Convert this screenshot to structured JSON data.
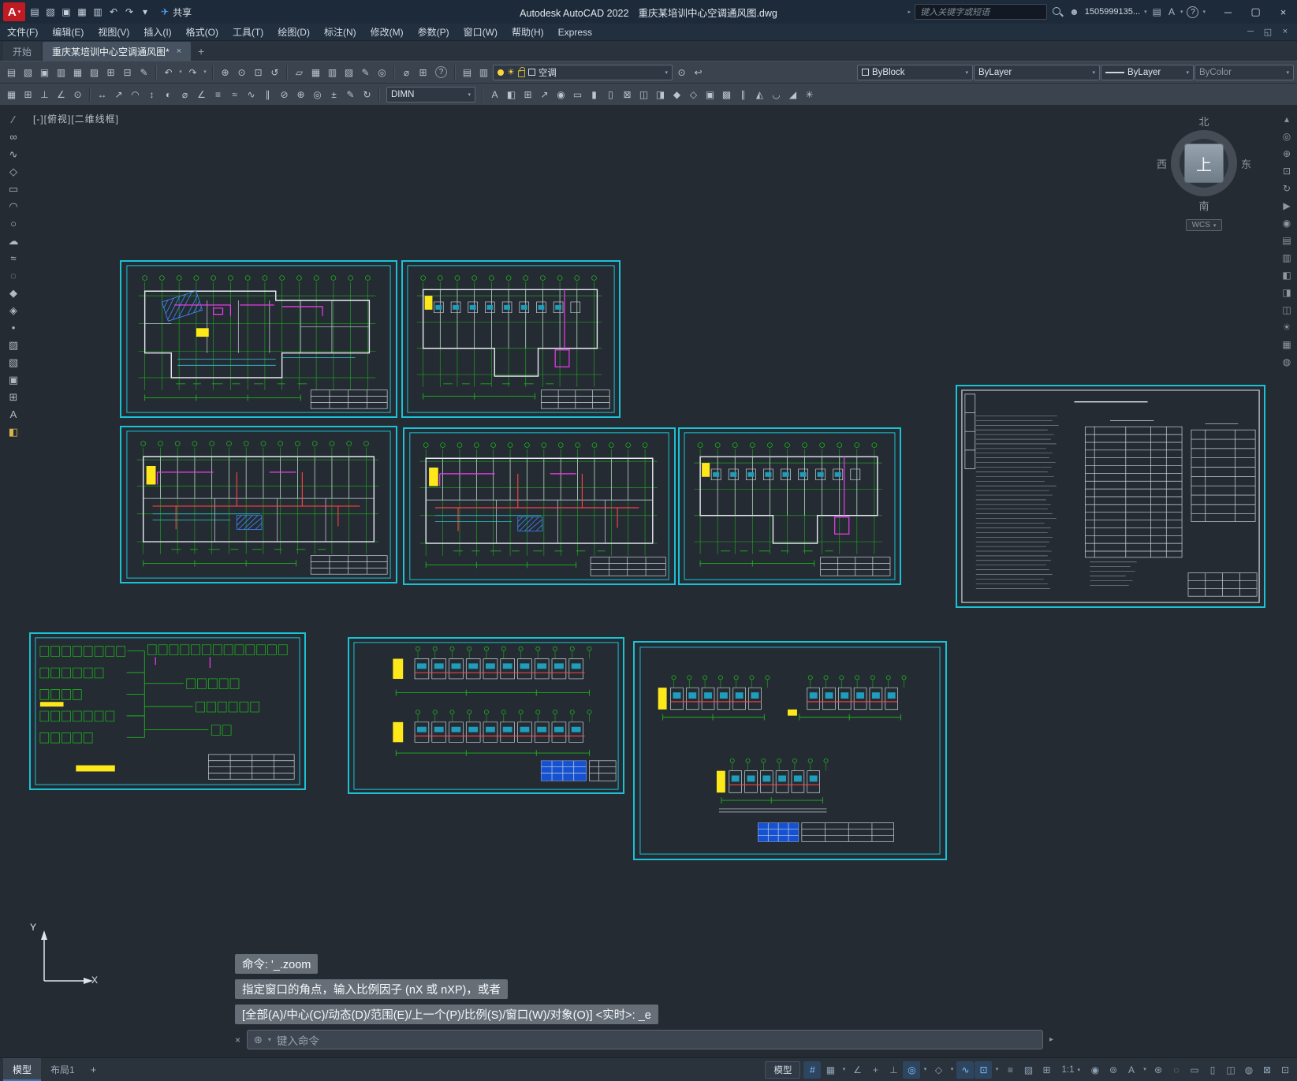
{
  "glyphs": {
    "logo_letter": "A",
    "dropdown": "▾",
    "minimize": "─",
    "maximize": "▢",
    "restore": "◱",
    "close": "×",
    "tab_close": "×",
    "add": "+",
    "share_plane": "✈",
    "avatar": "☻",
    "cart": "▤",
    "autodesk_a": "A",
    "help": "?",
    "sun": "☀",
    "input_gear": "⊛",
    "scroll_right": "▸"
  },
  "titlebar": {
    "app_title": "Autodesk AutoCAD 2022",
    "doc_title": "重庆某培训中心空调通风图.dwg",
    "share_label": "共享",
    "search_placeholder": "键入关键字或短语",
    "account": "1505999135...",
    "quick_icons": [
      {
        "name": "new-file-icon",
        "glyph": "▤"
      },
      {
        "name": "open-file-icon",
        "glyph": "▧"
      },
      {
        "name": "save-icon",
        "glyph": "▣"
      },
      {
        "name": "save-as-icon",
        "glyph": "▦"
      },
      {
        "name": "plot-icon",
        "glyph": "▥"
      },
      {
        "name": "undo-icon",
        "glyph": "↶"
      },
      {
        "name": "redo-icon",
        "glyph": "↷"
      },
      {
        "name": "qat-customize-icon",
        "glyph": "▾"
      }
    ]
  },
  "menubar": {
    "items": [
      {
        "name": "menu-file",
        "label": "文件(F)"
      },
      {
        "name": "menu-edit",
        "label": "编辑(E)"
      },
      {
        "name": "menu-view",
        "label": "视图(V)"
      },
      {
        "name": "menu-insert",
        "label": "插入(I)"
      },
      {
        "name": "menu-format",
        "label": "格式(O)"
      },
      {
        "name": "menu-tools",
        "label": "工具(T)"
      },
      {
        "name": "menu-draw",
        "label": "绘图(D)"
      },
      {
        "name": "menu-dimension",
        "label": "标注(N)"
      },
      {
        "name": "menu-modify",
        "label": "修改(M)"
      },
      {
        "name": "menu-parametric",
        "label": "参数(P)"
      },
      {
        "name": "menu-window",
        "label": "窗口(W)"
      },
      {
        "name": "menu-help",
        "label": "帮助(H)"
      },
      {
        "name": "menu-express",
        "label": "Express"
      }
    ]
  },
  "tabbar": {
    "start_label": "开始",
    "doc_label": "重庆某培训中心空调通风图*"
  },
  "toolbar1": {
    "layer_value": "空调",
    "color_value": "ByBlock",
    "linetype_value": "ByLayer",
    "lineweight_value": "ByLayer",
    "plotstyle_value": "ByColor",
    "icons_a": [
      {
        "name": "qnew-icon",
        "glyph": "▤"
      },
      {
        "name": "open-icon",
        "glyph": "▧"
      },
      {
        "name": "qsave-icon",
        "glyph": "▣"
      },
      {
        "name": "plot-icon",
        "glyph": "▥"
      },
      {
        "name": "plot-preview-icon",
        "glyph": "▦"
      },
      {
        "name": "publish-icon",
        "glyph": "▨"
      },
      {
        "name": "copy-clip-icon",
        "glyph": "⊞"
      },
      {
        "name": "paste-clip-icon",
        "glyph": "⊟"
      },
      {
        "name": "match-properties-icon",
        "glyph": "✎"
      }
    ],
    "icons_b": [
      {
        "name": "undo-icon",
        "glyph": "↶"
      },
      {
        "name": "undo-dropdown-icon",
        "glyph": "▾",
        "cls": "dd"
      },
      {
        "name": "redo-icon",
        "glyph": "↷"
      },
      {
        "name": "redo-dropdown-icon",
        "glyph": "▾",
        "cls": "dd"
      }
    ],
    "icons_c": [
      {
        "name": "pan-realtime-icon",
        "glyph": "⊕"
      },
      {
        "name": "zoom-realtime-icon",
        "gly9ph": "⊙",
        "glyph": "⊙"
      },
      {
        "name": "zoom-window-icon",
        "glyph": "⊡"
      },
      {
        "name": "zoom-previous-icon",
        "glyph": "↺"
      }
    ],
    "icons_d": [
      {
        "name": "properties-palette-icon",
        "glyph": "▱"
      },
      {
        "name": "design-center-icon",
        "glyph": "▦"
      },
      {
        "name": "tool-palettes-icon",
        "glyph": "▥"
      },
      {
        "name": "sheet-set-manager-icon",
        "glyph": "▨"
      },
      {
        "name": "markup-import-icon",
        "glyph": "✎"
      },
      {
        "name": "render-icon",
        "glyph": "◎"
      }
    ],
    "icons_e": [
      {
        "name": "measure-icon",
        "glyph": "⌀"
      },
      {
        "name": "quick-calc-icon",
        "glyph": "⊞"
      },
      {
        "name": "help-icon",
        "glyph": "?",
        "cls": "helpc"
      }
    ],
    "icons_f": [
      {
        "name": "layer-properties-manager-icon",
        "glyph": "▤"
      },
      {
        "name": "layer-states-icon",
        "glyph": "▥"
      }
    ],
    "icons_g": [
      {
        "name": "make-object-layer-current-icon",
        "glyph": "⊙"
      },
      {
        "name": "layer-previous-icon",
        "glyph": "↩"
      }
    ]
  },
  "toolbar2": {
    "dimstyle_value": "DIMN",
    "icons_a": [
      {
        "name": "snap-toggle-icon",
        "glyph": "▦"
      },
      {
        "name": "grid-toggle-icon",
        "glyph": "⊞"
      },
      {
        "name": "ortho-toggle-icon",
        "glyph": "⊥"
      },
      {
        "name": "polar-toggle-icon",
        "glyph": "∠"
      },
      {
        "name": "osnap-toggle-icon",
        "glyph": "⊙"
      }
    ],
    "icons_b": [
      {
        "name": "dim-linear-icon",
        "glyph": "↔"
      },
      {
        "name": "dim-aligned-icon",
        "glyph": "↗"
      },
      {
        "name": "dim-arc-icon",
        "glyph": "◠"
      },
      {
        "name": "dim-ordinate-icon",
        "glyph": "↕"
      },
      {
        "name": "dim-radius-icon",
        "glyph": "◐"
      },
      {
        "name": "dim-diameter-icon",
        "glyph": "⌀"
      },
      {
        "name": "dim-angular-icon",
        "glyph": "∠"
      },
      {
        "name": "dim-quick-icon",
        "glyph": "≡"
      },
      {
        "name": "dim-baseline-icon",
        "glyph": "≈"
      },
      {
        "name": "dim-continue-icon",
        "glyph": "∿"
      },
      {
        "name": "dim-space-icon",
        "glyph": "∥"
      },
      {
        "name": "dim-break-icon",
        "glyph": "⊘"
      },
      {
        "name": "tolerance-icon",
        "glyph": "⊕"
      },
      {
        "name": "center-mark-icon",
        "glyph": "◎"
      },
      {
        "name": "dim-jog-icon",
        "glyph": "±"
      },
      {
        "name": "dim-edit-icon",
        "glyph": "✎"
      },
      {
        "name": "dim-update-icon",
        "glyph": "↻"
      }
    ],
    "icons_c": [
      {
        "name": "text-style-icon",
        "glyph": "A"
      },
      {
        "name": "dim-style-icon",
        "glyph": "◧"
      },
      {
        "name": "table-style-icon",
        "glyph": "⊞"
      },
      {
        "name": "mleader-style-icon",
        "glyph": "↗"
      },
      {
        "name": "point-style-icon",
        "glyph": "◉"
      },
      {
        "name": "units-icon",
        "glyph": "▭"
      },
      {
        "name": "thickness-icon",
        "glyph": "▮"
      },
      {
        "name": "drawing-limits-icon",
        "glyph": "▯"
      },
      {
        "name": "osnap-settings-icon",
        "glyph": "⊠"
      },
      {
        "name": "object-group-icon",
        "glyph": "◫"
      },
      {
        "name": "xref-icon",
        "glyph": "◨"
      },
      {
        "name": "block-editor-icon",
        "glyph": "◆"
      },
      {
        "name": "insert-block-icon",
        "glyph": "◇"
      },
      {
        "name": "wblock-icon",
        "glyph": "▣"
      },
      {
        "name": "array-icon",
        "glyph": "▩"
      },
      {
        "name": "offset-icon",
        "glyph": "∥"
      },
      {
        "name": "mirror-icon",
        "glyph": "◭"
      },
      {
        "name": "fillet-icon",
        "glyph": "◡"
      },
      {
        "name": "chamfer-icon",
        "glyph": "◢"
      },
      {
        "name": "explode-icon",
        "glyph": "✳"
      }
    ]
  },
  "lefttools": {
    "icons": [
      {
        "name": "line-tool-icon",
        "glyph": "∕"
      },
      {
        "name": "construction-line-tool-icon",
        "glyph": "∞"
      },
      {
        "name": "polyline-tool-icon",
        "glyph": "∿"
      },
      {
        "name": "polygon-tool-icon",
        "glyph": "◇"
      },
      {
        "name": "rectangle-tool-icon",
        "glyph": "▭"
      },
      {
        "name": "arc-tool-icon",
        "glyph": "◠"
      },
      {
        "name": "circle-tool-icon",
        "glyph": "○"
      },
      {
        "name": "revision-cloud-tool-icon",
        "glyph": "☁"
      },
      {
        "name": "spline-tool-icon",
        "glyph": "≈"
      },
      {
        "name": "ellipse-tool-icon",
        "glyph": "◌"
      },
      {
        "name": "insert-block-tool-icon",
        "glyph": "◆"
      },
      {
        "name": "make-block-tool-icon",
        "glyph": "◈"
      },
      {
        "name": "point-tool-icon",
        "glyph": "•"
      },
      {
        "name": "hatch-tool-icon",
        "glyph": "▨"
      },
      {
        "name": "gradient-tool-icon",
        "glyph": "▧"
      },
      {
        "name": "region-tool-icon",
        "glyph": "▣"
      },
      {
        "name": "table-tool-icon",
        "glyph": "⊞"
      },
      {
        "name": "text-tool-icon",
        "glyph": "A"
      },
      {
        "name": "color-palette-icon",
        "glyph": "◧",
        "cls": "colorful"
      }
    ]
  },
  "rightnav": {
    "icons": [
      {
        "name": "navbar-customize-icon",
        "glyph": "▴"
      },
      {
        "name": "full-navigation-wheel-icon",
        "glyph": "◎"
      },
      {
        "name": "pan-tool-icon",
        "glyph": "⊕"
      },
      {
        "name": "zoom-extents-icon",
        "glyph": "⊡"
      },
      {
        "name": "orbit-tool-icon",
        "glyph": "↻"
      },
      {
        "name": "show-motion-icon",
        "glyph": "▶"
      },
      {
        "name": "viewcube-settings-icon",
        "glyph": "◉"
      },
      {
        "name": "layer-walk-icon",
        "glyph": "▤"
      },
      {
        "name": "view-manager-icon",
        "glyph": "▥"
      },
      {
        "name": "visual-styles-icon",
        "glyph": "◧"
      },
      {
        "name": "section-plane-icon",
        "glyph": "◨"
      },
      {
        "name": "camera-icon",
        "glyph": "◫"
      },
      {
        "name": "sun-properties-icon",
        "glyph": "☀"
      },
      {
        "name": "materials-icon",
        "glyph": "▦"
      },
      {
        "name": "render-settings-icon",
        "glyph": "◍"
      }
    ]
  },
  "canvas": {
    "viewport_label": "[-][俯视][二维线框]",
    "viewcube": {
      "north": "北",
      "south": "南",
      "west": "西",
      "east": "东",
      "top": "上",
      "wcs_label": "WCS"
    },
    "ucs": {
      "x_label": "X",
      "y_label": "Y"
    }
  },
  "command": {
    "history": [
      "命令: '_.zoom",
      "指定窗口的角点，输入比例因子 (nX 或 nXP)，或者",
      "[全部(A)/中心(C)/动态(D)/范围(E)/上一个(P)/比例(S)/窗口(W)/对象(O)] <实时>: _e"
    ],
    "input_placeholder": "键入命令"
  },
  "statusbar": {
    "model_tab": "模型",
    "layout_tab": "布局1",
    "add_tab": "+",
    "model_button": "模型",
    "scale_value": "1:1",
    "icons_a": [
      {
        "name": "grid-display-icon",
        "glyph": "#",
        "accent": true
      },
      {
        "name": "snap-mode-icon",
        "glyph": "▦"
      },
      {
        "name": "snap-dropdown-icon",
        "glyph": "▾",
        "cls": "dd"
      },
      {
        "name": "infer-constraints-icon",
        "glyph": "∠"
      },
      {
        "name": "dynamic-input-icon",
        "glyph": "+"
      },
      {
        "name": "ortho-mode-icon",
        "glyph": "⊥"
      },
      {
        "name": "polar-tracking-icon",
        "glyph": "◎",
        "accent": true
      },
      {
        "name": "polar-dropdown-icon",
        "glyph": "▾",
        "cls": "dd"
      },
      {
        "name": "isometric-drafting-icon",
        "glyph": "◇"
      },
      {
        "name": "iso-dropdown-icon",
        "glyph": "▾",
        "cls": "dd"
      },
      {
        "name": "object-snap-tracking-icon",
        "glyph": "∿",
        "accent": true
      },
      {
        "name": "object-snap-icon",
        "glyph": "⊡",
        "accent": true
      },
      {
        "name": "osnap-dropdown-icon",
        "glyph": "▾",
        "cls": "dd"
      },
      {
        "name": "lineweight-display-icon",
        "glyph": "≡"
      },
      {
        "name": "transparency-icon",
        "glyph": "▨"
      },
      {
        "name": "selection-cycling-icon",
        "glyph": "⊞"
      }
    ],
    "icons_b": [
      {
        "name": "annotation-visibility-icon",
        "glyph": "◉"
      },
      {
        "name": "autoscale-icon",
        "glyph": "⊚"
      },
      {
        "name": "annotation-scale-a-icon",
        "glyph": "A"
      },
      {
        "name": "anno-dropdown-icon",
        "glyph": "▾",
        "cls": "dd"
      },
      {
        "name": "workspace-switching-icon",
        "glyph": "⊛"
      },
      {
        "name": "annotation-monitor-icon",
        "glyph": "◌"
      },
      {
        "name": "units-display-icon",
        "glyph": "▭"
      },
      {
        "name": "quick-properties-icon",
        "glyph": "▯"
      },
      {
        "name": "lock-ui-icon",
        "glyph": "◫"
      },
      {
        "name": "isolate-objects-icon",
        "glyph": "◍"
      },
      {
        "name": "graphics-performance-icon",
        "glyph": "⊠"
      },
      {
        "name": "clean-screen-icon",
        "glyph": "⊡"
      }
    ]
  }
}
